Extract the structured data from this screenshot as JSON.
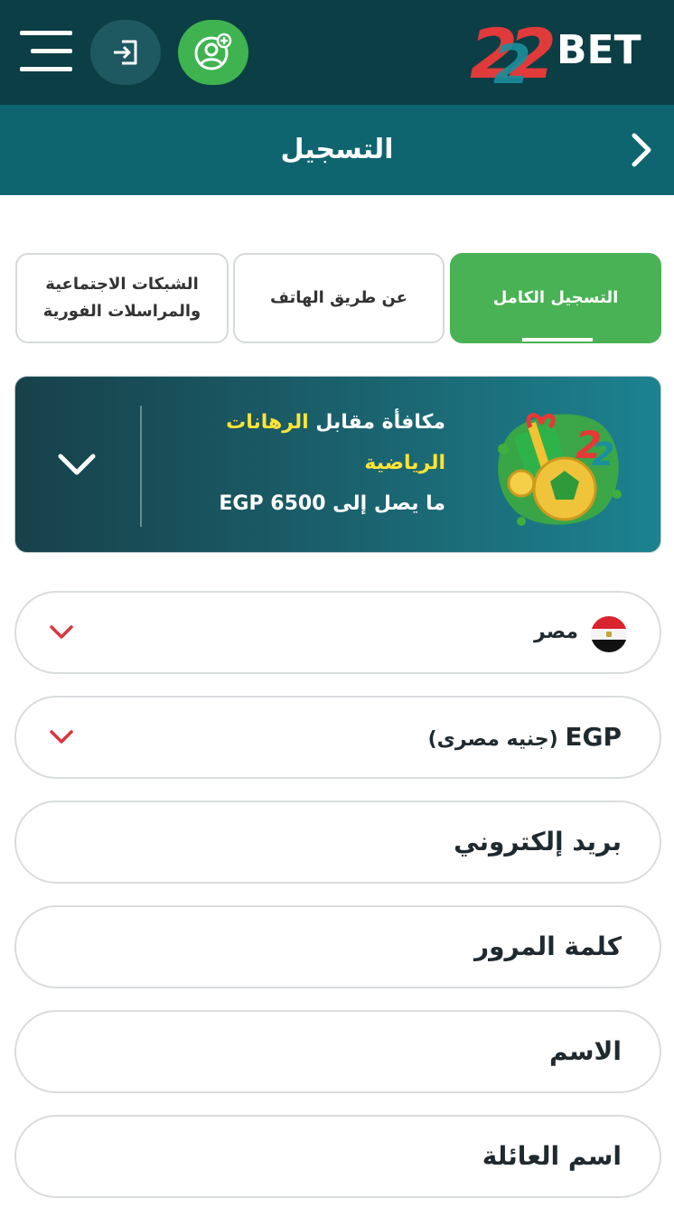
{
  "header": {
    "brand": "22BET",
    "brand_number": "22",
    "brand_word": "BET",
    "menu_icon": "hamburger-menu-icon",
    "login_icon": "login-icon",
    "register_icon": "add-user-icon"
  },
  "titlebar": {
    "title": "التسجيل",
    "back_icon": "chevron-right-icon"
  },
  "tabs": [
    {
      "label": "التسجيل الكامل",
      "active": true
    },
    {
      "label": "عن طريق الهاتف",
      "active": false
    },
    {
      "label_line1": "الشبكات الاجتماعية",
      "label_line2": "والمراسلات الفورية",
      "active": false
    }
  ],
  "bonus": {
    "prefix": "مكافأة مقابل ",
    "highlight_1": "الرهانات",
    "highlight_2": "الرياضية",
    "amount_prefix": "ما يصل إلى ",
    "amount": "6500 EGP",
    "expand_icon": "chevron-down-icon"
  },
  "form": {
    "country": "مصر",
    "currency_code": "EGP",
    "currency_name": "(جنيه مصرى)",
    "email_placeholder": "بريد إلكتروني",
    "password_placeholder": "كلمة المرور",
    "name_placeholder": "الاسم",
    "surname_placeholder": "اسم العائلة"
  },
  "colors": {
    "header_bg": "#0b3e45",
    "titlebar_bg": "#0e6570",
    "accent_green": "#49b254",
    "chevron_red": "#d9363e",
    "bonus_yellow": "#ffe437"
  }
}
